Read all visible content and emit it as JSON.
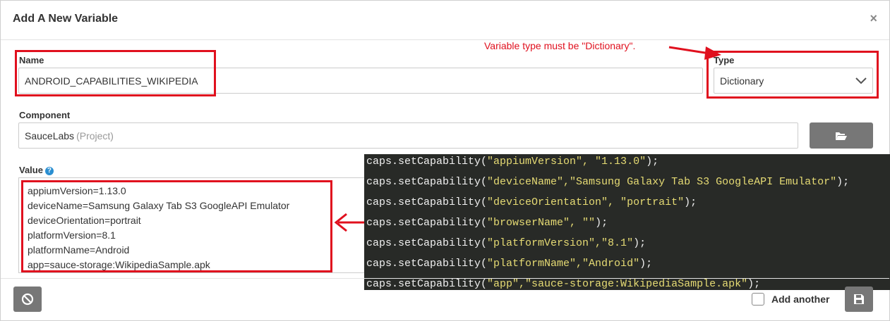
{
  "dialog": {
    "title": "Add A New Variable",
    "close_icon": "×"
  },
  "name": {
    "label": "Name",
    "value": "ANDROID_CAPABILITIES_WIKIPEDIA"
  },
  "type": {
    "label": "Type",
    "selected": "Dictionary"
  },
  "component": {
    "label": "Component",
    "value": "SauceLabs",
    "suffix": "(Project)",
    "browse_icon": "folder-open-icon"
  },
  "value": {
    "label": "Value",
    "help_icon": "?",
    "lines": [
      "appiumVersion=1.13.0",
      "deviceName=Samsung Galaxy Tab S3 GoogleAPI Emulator",
      "deviceOrientation=portrait",
      "platformVersion=8.1",
      "platformName=Android",
      "app=sauce-storage:WikipediaSample.apk"
    ]
  },
  "annotation": {
    "text": "Variable type must be \"Dictionary\"."
  },
  "code": {
    "lines": [
      {
        "pre": "caps.setCapability(",
        "str": "\"appiumVersion\", \"1.13.0\"",
        "post": ");"
      },
      {
        "pre": "caps.setCapability(",
        "str": "\"deviceName\",\"Samsung Galaxy Tab S3 GoogleAPI Emulator\"",
        "post": ");"
      },
      {
        "pre": "caps.setCapability(",
        "str": "\"deviceOrientation\", \"portrait\"",
        "post": ");"
      },
      {
        "pre": "caps.setCapability(",
        "str": "\"browserName\", \"\"",
        "post": ");"
      },
      {
        "pre": "caps.setCapability(",
        "str": "\"platformVersion\",\"8.1\"",
        "post": ");"
      },
      {
        "pre": "caps.setCapability(",
        "str": "\"platformName\",\"Android\"",
        "post": ");"
      },
      {
        "pre": "caps.setCapability(",
        "str": "\"app\",\"sauce-storage:WikipediaSample.apk\"",
        "post": ");"
      }
    ]
  },
  "footer": {
    "cancel_icon": "ban-icon",
    "add_another_label": "Add another",
    "save_icon": "save-icon"
  },
  "colors": {
    "annotation": "#e0101e",
    "code_background": "#282a27",
    "code_string": "#e6db74"
  }
}
